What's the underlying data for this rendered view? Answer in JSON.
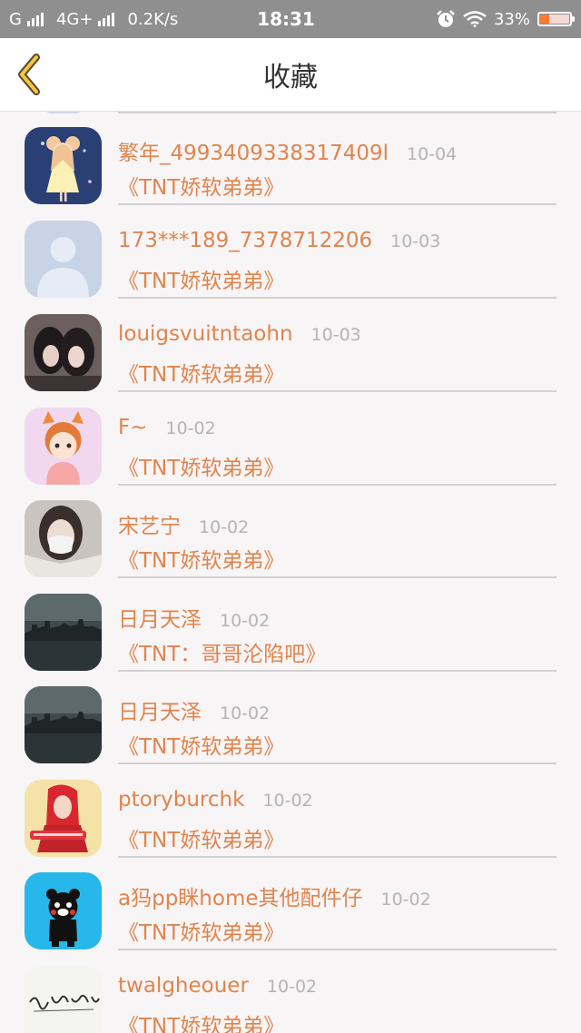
{
  "status_bar": {
    "carrier": "G",
    "network": "4G+",
    "speed": "0.2K/s",
    "time": "18:31",
    "battery": "33%"
  },
  "header": {
    "title": "收藏"
  },
  "items": [
    {
      "name": "繁年_4993409338317409l",
      "date": "10-04",
      "book": "《TNT娇软弟弟》",
      "avatar": "anime-girl"
    },
    {
      "name": "173***189_7378712206",
      "date": "10-03",
      "book": "《TNT娇软弟弟》",
      "avatar": "default-person"
    },
    {
      "name": "louigsvuitntaohn",
      "date": "10-03",
      "book": "《TNT娇软弟弟》",
      "avatar": "two-girls-photo"
    },
    {
      "name": "F~",
      "date": "10-02",
      "book": "《TNT娇软弟弟》",
      "avatar": "cartoon-fox-boy"
    },
    {
      "name": "宋艺宁",
      "date": "10-02",
      "book": "《TNT娇软弟弟》",
      "avatar": "masked-girl-photo"
    },
    {
      "name": "日月天泽",
      "date": "10-02",
      "book": "《TNT：哥哥沦陷吧》",
      "avatar": "city-night"
    },
    {
      "name": "日月天泽",
      "date": "10-02",
      "book": "《TNT娇软弟弟》",
      "avatar": "city-night"
    },
    {
      "name": "ptoryburchk",
      "date": "10-02",
      "book": "《TNT娇软弟弟》",
      "avatar": "red-hood-girl"
    },
    {
      "name": "a犸pp眯home其他配件仔",
      "date": "10-02",
      "book": "《TNT娇软弟弟》",
      "avatar": "kumamon-bear"
    },
    {
      "name": "twalgheouer",
      "date": "10-02",
      "book": "《TNT娇软弟弟》",
      "avatar": "handwriting"
    }
  ]
}
